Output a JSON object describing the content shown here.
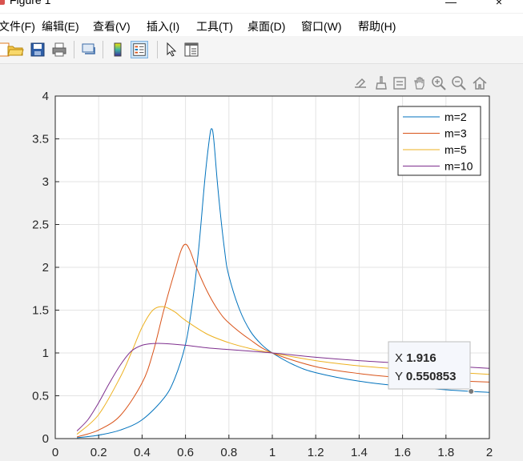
{
  "window": {
    "title": "Figure 1",
    "minimize": "—",
    "close": "×"
  },
  "menu": [
    "文件(F)",
    "编辑(E)",
    "查看(V)",
    "插入(I)",
    "工具(T)",
    "桌面(D)",
    "窗口(W)",
    "帮助(H)"
  ],
  "toolbar": [
    "new-figure-icon",
    "open-folder-icon",
    "save-icon",
    "print-icon",
    "link-plot-icon",
    "insert-colorbar-icon",
    "insert-legend-icon",
    "pointer-icon",
    "property-inspector-icon"
  ],
  "axes_toolbar": [
    "export-icon",
    "brush-icon",
    "data-tips-icon",
    "pan-hand-icon",
    "zoom-in-icon",
    "zoom-out-icon",
    "home-icon"
  ],
  "chart_data": {
    "type": "line",
    "title": "",
    "xlabel": "",
    "ylabel": "",
    "xlim": [
      0,
      2
    ],
    "ylim": [
      0,
      4
    ],
    "xticks": [
      "0",
      "0.2",
      "0.4",
      "0.6",
      "0.8",
      "1",
      "1.2",
      "1.4",
      "1.6",
      "1.8",
      "2"
    ],
    "yticks": [
      "0",
      "0.5",
      "1",
      "1.5",
      "2",
      "2.5",
      "3",
      "3.5",
      "4"
    ],
    "grid": true,
    "legend_position": "top-right",
    "series": [
      {
        "name": "m=2",
        "color": "#0072bd",
        "x": [
          0.1,
          0.2,
          0.3,
          0.4,
          0.5,
          0.55,
          0.6,
          0.63,
          0.66,
          0.69,
          0.71,
          0.72,
          0.73,
          0.75,
          0.78,
          0.8,
          0.85,
          0.9,
          0.95,
          1.0,
          1.1,
          1.2,
          1.4,
          1.6,
          1.8,
          1.916,
          2.0
        ],
        "y": [
          0.01,
          0.04,
          0.1,
          0.22,
          0.47,
          0.7,
          1.1,
          1.55,
          2.2,
          3.05,
          3.5,
          3.62,
          3.5,
          2.9,
          2.2,
          1.9,
          1.5,
          1.25,
          1.1,
          1.0,
          0.86,
          0.77,
          0.67,
          0.61,
          0.57,
          0.551,
          0.54
        ]
      },
      {
        "name": "m=3",
        "color": "#d95319",
        "x": [
          0.1,
          0.2,
          0.3,
          0.4,
          0.45,
          0.5,
          0.55,
          0.58,
          0.6,
          0.62,
          0.65,
          0.7,
          0.75,
          0.8,
          0.9,
          1.0,
          1.2,
          1.4,
          1.6,
          1.8,
          2.0
        ],
        "y": [
          0.02,
          0.1,
          0.27,
          0.65,
          1.0,
          1.5,
          1.95,
          2.2,
          2.27,
          2.2,
          2.0,
          1.72,
          1.5,
          1.35,
          1.15,
          1.0,
          0.84,
          0.76,
          0.71,
          0.68,
          0.66
        ]
      },
      {
        "name": "m=5",
        "color": "#edb120",
        "x": [
          0.1,
          0.2,
          0.3,
          0.35,
          0.4,
          0.45,
          0.5,
          0.55,
          0.6,
          0.7,
          0.8,
          0.9,
          1.0,
          1.2,
          1.4,
          1.6,
          1.8,
          2.0
        ],
        "y": [
          0.05,
          0.28,
          0.72,
          1.0,
          1.3,
          1.5,
          1.54,
          1.48,
          1.38,
          1.22,
          1.12,
          1.05,
          1.0,
          0.91,
          0.85,
          0.81,
          0.78,
          0.75
        ]
      },
      {
        "name": "m=10",
        "color": "#7e2f8e",
        "x": [
          0.1,
          0.15,
          0.2,
          0.25,
          0.3,
          0.35,
          0.4,
          0.45,
          0.5,
          0.6,
          0.7,
          0.8,
          1.0,
          1.2,
          1.4,
          1.6,
          1.8,
          2.0
        ],
        "y": [
          0.09,
          0.22,
          0.42,
          0.65,
          0.86,
          1.02,
          1.09,
          1.11,
          1.11,
          1.09,
          1.06,
          1.04,
          1.0,
          0.95,
          0.91,
          0.88,
          0.85,
          0.82
        ]
      }
    ],
    "datatip": {
      "x_label": "X",
      "x_value": "1.916",
      "y_label": "Y",
      "y_value": "0.550853",
      "x": 1.916,
      "y": 0.550853
    }
  }
}
